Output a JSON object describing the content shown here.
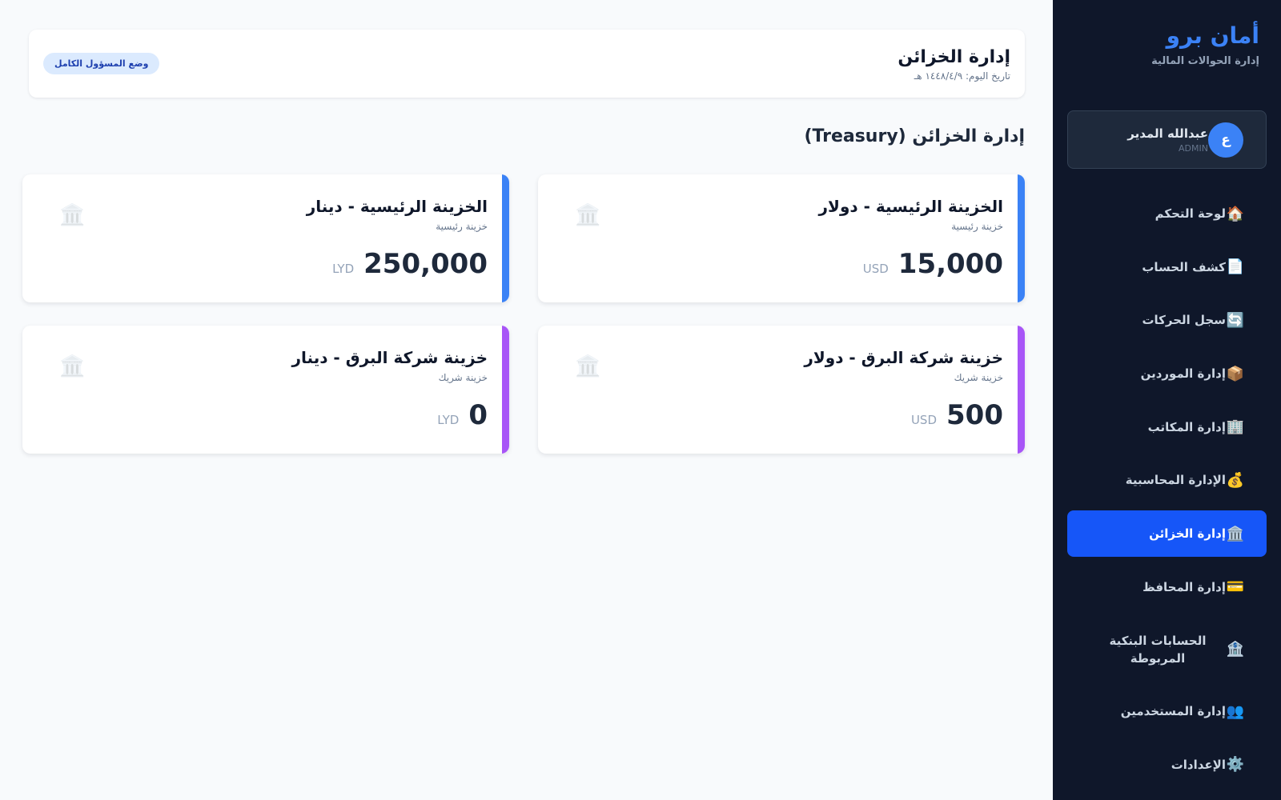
{
  "sidebar": {
    "brand_title": "أمان برو",
    "brand_subtitle": "إدارة الحوالات المالية",
    "user": {
      "initial": "ع",
      "name": "عبدالله المدير",
      "role": "ADMIN"
    },
    "items": [
      {
        "icon": "🏠",
        "label": "لوحة التحكم"
      },
      {
        "icon": "📄",
        "label": "كشف الحساب"
      },
      {
        "icon": "🔄",
        "label": "سجل الحركات"
      },
      {
        "icon": "📦",
        "label": "إدارة الموردين"
      },
      {
        "icon": "🏢",
        "label": "إدارة المكاتب"
      },
      {
        "icon": "💰",
        "label": "الإدارة المحاسبية"
      },
      {
        "icon": "🏛️",
        "label": "إدارة الخزائن",
        "active": true
      },
      {
        "icon": "💳",
        "label": "إدارة المحافظ"
      },
      {
        "icon": "🏦",
        "label": "الحسابات البنكية المربوطة"
      },
      {
        "icon": "👥",
        "label": "إدارة المستخدمين"
      },
      {
        "icon": "⚙️",
        "label": "الإعدادات"
      }
    ]
  },
  "header": {
    "title": "إدارة الخزائن",
    "date": "تاريخ اليوم: ١٤٤٨/٤/٩ هـ",
    "badge": "وضع المسؤول الكامل"
  },
  "main": {
    "section_title": "إدارة الخزائن (Treasury)",
    "cards": [
      {
        "name": "الخزينة الرئيسية - دولار",
        "type": "خزينة رئيسية",
        "amount": "15,000",
        "currency": "USD",
        "accent": "#3b82f6",
        "icon": "🏛️"
      },
      {
        "name": "الخزينة الرئيسية - دينار",
        "type": "خزينة رئيسية",
        "amount": "250,000",
        "currency": "LYD",
        "accent": "#3b82f6",
        "icon": "🏛️"
      },
      {
        "name": "خزينة شركة البرق - دولار",
        "type": "خزينة شريك",
        "amount": "500",
        "currency": "USD",
        "accent": "#a855f7",
        "icon": "🏛️"
      },
      {
        "name": "خزينة شركة البرق - دينار",
        "type": "خزينة شريك",
        "amount": "0",
        "currency": "LYD",
        "accent": "#a855f7",
        "icon": "🏛️"
      }
    ]
  }
}
